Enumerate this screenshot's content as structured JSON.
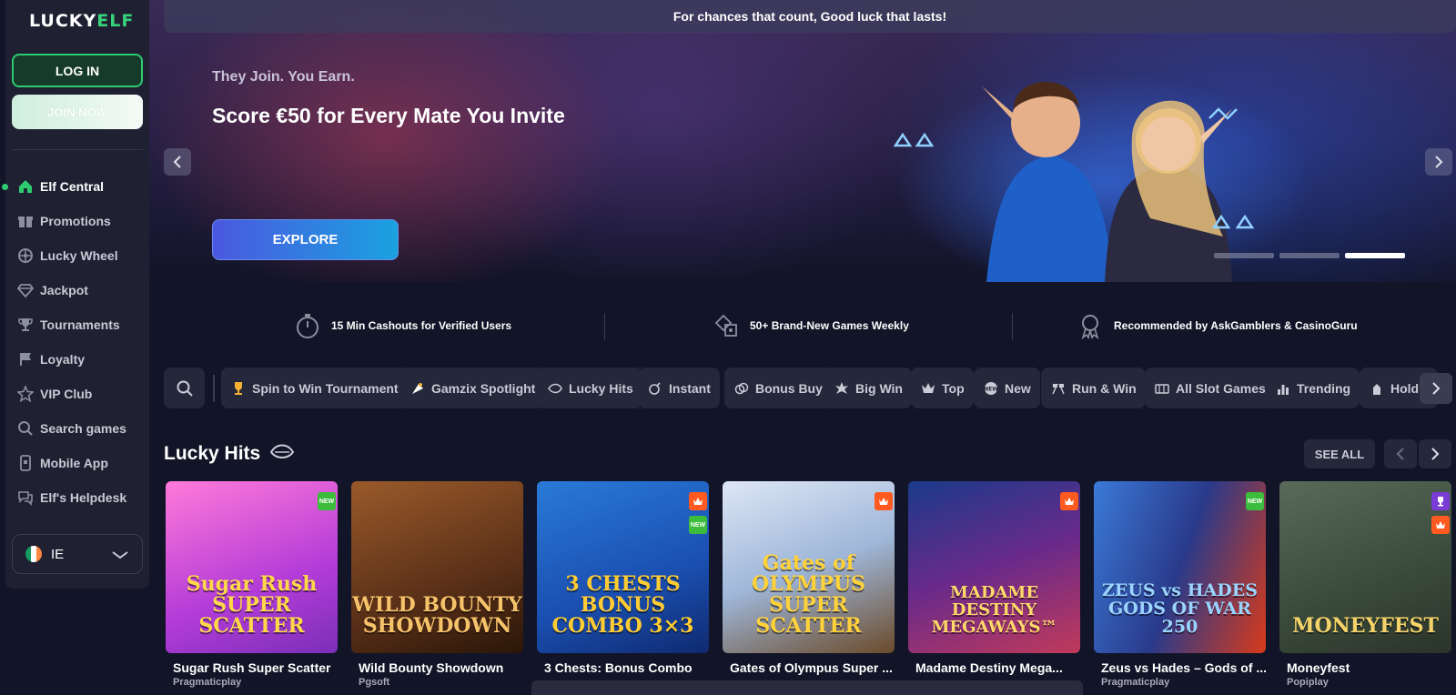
{
  "sidebar": {
    "logo": {
      "lucky": "LUCKY",
      "elf": "ELF"
    },
    "login_label": "LOG IN",
    "join_label": "JOIN NOW",
    "items": [
      {
        "label": "Elf Central",
        "icon": "home-icon",
        "active": true
      },
      {
        "label": "Promotions",
        "icon": "gift-icon"
      },
      {
        "label": "Lucky Wheel",
        "icon": "wheel-icon"
      },
      {
        "label": "Jackpot",
        "icon": "diamond-icon"
      },
      {
        "label": "Tournaments",
        "icon": "trophy-icon"
      },
      {
        "label": "Loyalty",
        "icon": "flag-icon"
      },
      {
        "label": "VIP Club",
        "icon": "star-icon"
      },
      {
        "label": "Search games",
        "icon": "search-icon"
      },
      {
        "label": "Mobile App",
        "icon": "mobile-icon"
      },
      {
        "label": "Elf's Helpdesk",
        "icon": "chat-icon"
      }
    ],
    "language": {
      "code": "IE"
    }
  },
  "banner": {
    "strip_text": "For chances that count, Good luck that lasts!",
    "subtitle": "They Join. You Earn.",
    "title": "Score €50 for Every Mate You Invite",
    "cta_label": "EXPLORE",
    "slides_total": 3,
    "slide_active": 3
  },
  "features": [
    {
      "label": "15 Min Cashouts for Verified Users",
      "icon": "stopwatch-icon"
    },
    {
      "label": "50+ Brand-New Games Weekly",
      "icon": "dice-icon"
    },
    {
      "label": "Recommended by AskGamblers & CasinoGuru",
      "icon": "award-icon"
    }
  ],
  "categories": [
    {
      "label": "Spin to Win Tournament",
      "icon": "trophy-icon"
    },
    {
      "label": "Gamzix Spotlight",
      "icon": "spotlight-icon"
    },
    {
      "label": "Lucky Hits",
      "icon": "leaf-icon"
    },
    {
      "label": "Instant",
      "icon": "bomb-icon"
    },
    {
      "label": "Bonus Buy",
      "icon": "coins-icon"
    },
    {
      "label": "Big Win",
      "icon": "burst-icon"
    },
    {
      "label": "Top",
      "icon": "crown-icon"
    },
    {
      "label": "New",
      "icon": "new-icon"
    },
    {
      "label": "Run & Win",
      "icon": "flags-icon"
    },
    {
      "label": "All Slot Games",
      "icon": "slot-icon"
    },
    {
      "label": "Trending",
      "icon": "bars-icon"
    },
    {
      "label": "Hold",
      "icon": "hold-icon"
    }
  ],
  "section": {
    "title": "Lucky Hits",
    "see_all_label": "SEE ALL"
  },
  "games": [
    {
      "name": "Sugar Rush Super Scatter",
      "provider": "Pragmaticplay",
      "art": "Sugar Rush\nSUPER SCATTER",
      "badges": [
        "new"
      ]
    },
    {
      "name": "Wild Bounty Showdown",
      "provider": "Pgsoft",
      "art": "WILD BOUNTY\nSHOWDOWN",
      "badges": []
    },
    {
      "name": "3 Chests: Bonus Combo",
      "provider": "",
      "art": "3 CHESTS\nBONUS COMBO 3×3",
      "badges": [
        "top",
        "new"
      ]
    },
    {
      "name": "Gates of Olympus Super ...",
      "provider": "",
      "art": "Gates of\nOLYMPUS\nSUPER SCATTER",
      "badges": [
        "top"
      ]
    },
    {
      "name": "Madame Destiny Mega...",
      "provider": "",
      "art": "MADAME DESTINY\nMEGAWAYS™",
      "badges": [
        "top"
      ]
    },
    {
      "name": "Zeus vs Hades – Gods of ...",
      "provider": "Pragmaticplay",
      "art": "ZEUS vs HADES\nGODS OF WAR\n250",
      "badges": [
        "new"
      ]
    },
    {
      "name": "Moneyfest",
      "provider": "Popiplay",
      "art": "MONEYFEST",
      "badges": [
        "trophy",
        "top"
      ]
    }
  ],
  "colors": {
    "accent": "#2ecc71",
    "background": "#121427",
    "chip": "#25273a",
    "hot_badge": "#ff5a1f",
    "new_badge": "#3cbc3c"
  }
}
